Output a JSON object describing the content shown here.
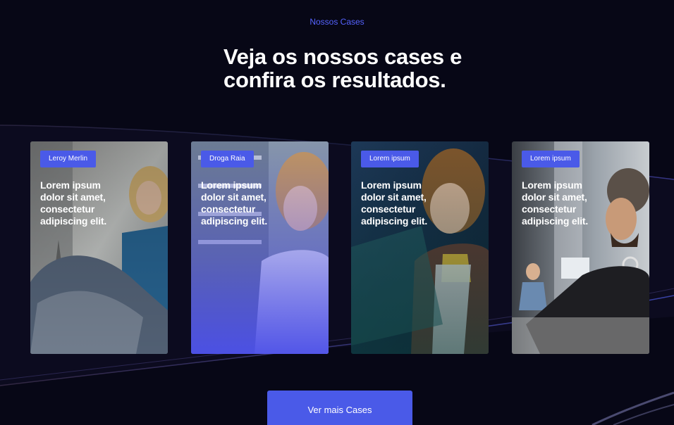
{
  "section": {
    "eyebrow": "Nossos Cases",
    "title_line1": "Veja os nossos cases e",
    "title_line2": "confira os resultados."
  },
  "cases": [
    {
      "tag": "Leroy Merlin",
      "text": "Lorem ipsum dolor sit amet, consectetur adipiscing elit."
    },
    {
      "tag": "Droga Raia",
      "text": "Lorem ipsum dolor sit amet, consectetur adipiscing elit."
    },
    {
      "tag": "Lorem ipsum",
      "text": "Lorem ipsum dolor sit amet, consectetur adipiscing elit."
    },
    {
      "tag": "Lorem ipsum",
      "text": "Lorem ipsum dolor sit amet, consectetur adipiscing elit."
    }
  ],
  "cta": {
    "label": "Ver mais Cases"
  },
  "colors": {
    "accent": "#4a5ae8",
    "eyebrow": "#5563ff",
    "background": "#070716"
  }
}
